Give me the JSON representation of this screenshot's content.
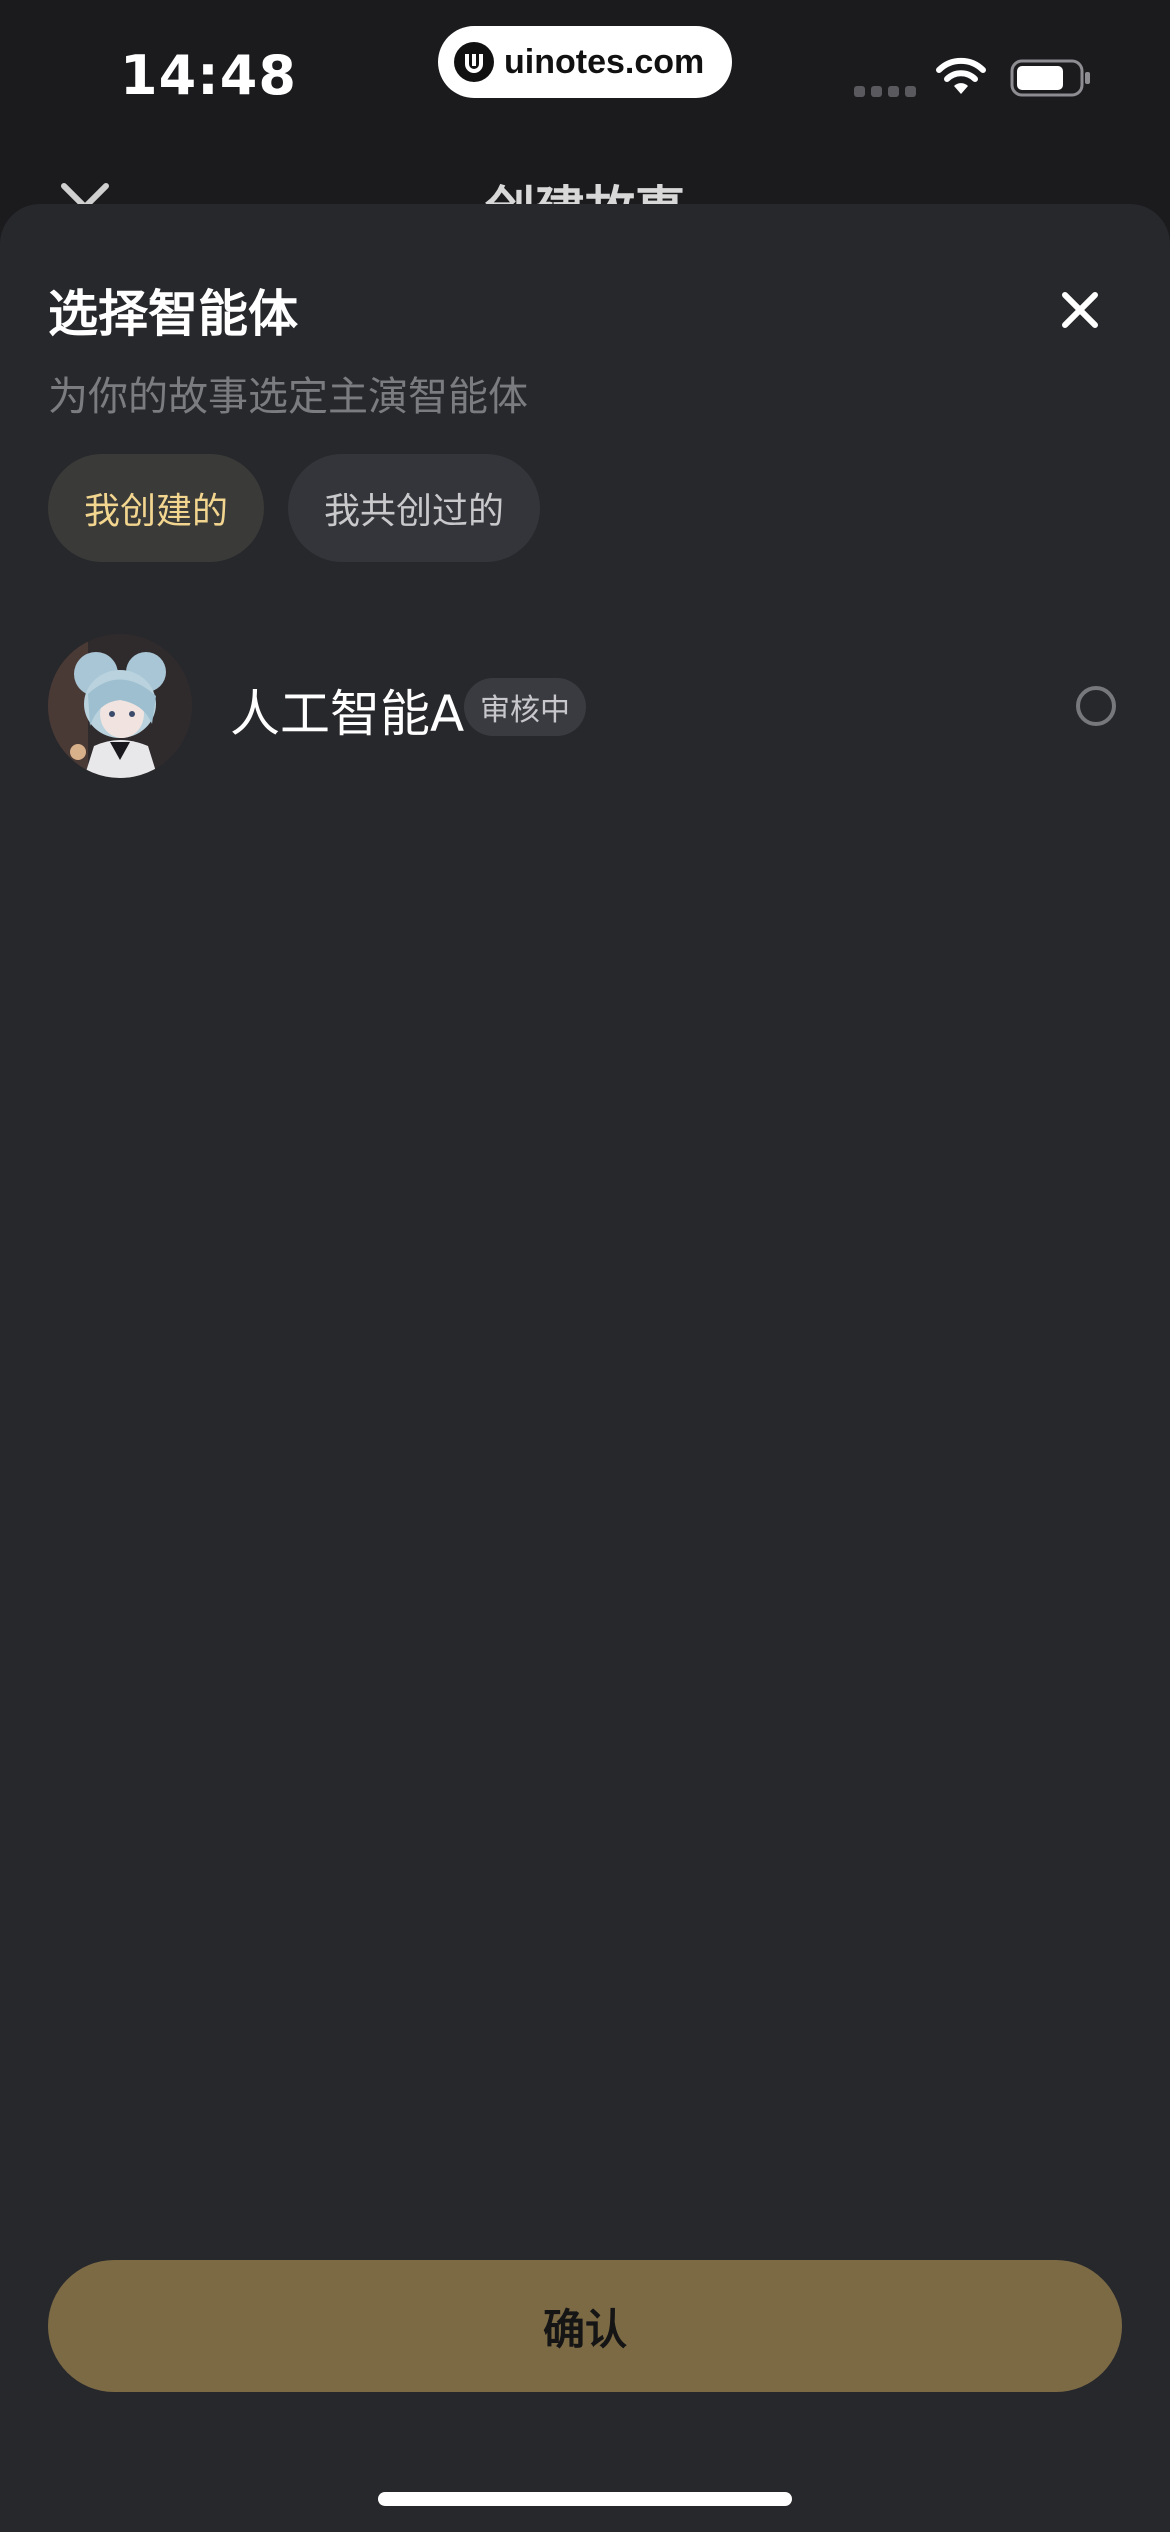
{
  "status_bar": {
    "time": "14:48",
    "watermark": "uinotes.com"
  },
  "background_page": {
    "title": "创建故事"
  },
  "sheet": {
    "title": "选择智能体",
    "subtitle": "为你的故事选定主演智能体",
    "tabs": [
      {
        "label": "我创建的",
        "selected": true
      },
      {
        "label": "我共创过的",
        "selected": false
      }
    ],
    "agents": [
      {
        "name": "人工智能A",
        "status": "审核中",
        "selected": false
      }
    ],
    "confirm_label": "确认"
  },
  "colors": {
    "sheet_bg": "#27282c",
    "accent_text": "#f2d58f",
    "confirm_bg": "#7c6a45"
  }
}
